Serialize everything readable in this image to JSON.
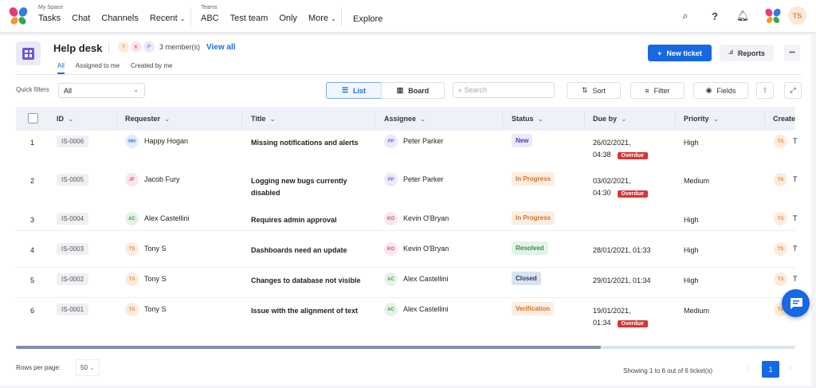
{
  "nav": {
    "my_space_label": "My Space",
    "my_space_items": [
      "Tasks",
      "Chat",
      "Channels",
      "Recent"
    ],
    "teams_label": "Teams",
    "team_items": [
      "ABC",
      "Test team",
      "Only",
      "More"
    ],
    "explore": "Explore",
    "user_initials": "TS"
  },
  "header": {
    "title": "Help desk",
    "members": [
      "T",
      "K",
      "P"
    ],
    "member_count": "3 member(s)",
    "view_all": "View all",
    "tabs": [
      "All",
      "Assigned to me",
      "Created by me"
    ],
    "new_ticket": "New ticket",
    "reports": "Reports",
    "more": "•••"
  },
  "toolbar": {
    "quick_filters_label": "Quick filters",
    "quick_filter_value": "All",
    "list": "List",
    "board": "Board",
    "search_placeholder": "Search",
    "sort": "Sort",
    "filter": "Filter",
    "fields": "Fields"
  },
  "columns": [
    "ID",
    "Requester",
    "Title",
    "Assignee",
    "Status",
    "Due by",
    "Priority",
    "Create"
  ],
  "rows": [
    {
      "n": "1",
      "id": "IS-0006",
      "req_init": "HH",
      "req": "Happy Hogan",
      "title": [
        "Missing notifications and alerts"
      ],
      "asg_init": "PP",
      "asg": "Peter Parker",
      "status": "New",
      "due": [
        "26/02/2021,",
        "04:38"
      ],
      "overdue": "Overdue",
      "priority": "High",
      "created_init": "TS",
      "created": "T"
    },
    {
      "n": "2",
      "id": "IS-0005",
      "req_init": "JF",
      "req": "Jacob Fury",
      "title": [
        "Logging new bugs currently",
        "disabled"
      ],
      "asg_init": "PP",
      "asg": "Peter Parker",
      "status": "In Progress",
      "due": [
        "03/02/2021,",
        "04:30"
      ],
      "overdue": "Overdue",
      "priority": "Medium",
      "created_init": "TS",
      "created": "T"
    },
    {
      "n": "3",
      "id": "IS-0004",
      "req_init": "AC",
      "req": "Alex Castellini",
      "title": [
        "Requires admin approval"
      ],
      "asg_init": "KO",
      "asg": "Kevin O'Bryan",
      "status": "In Progress",
      "due": [],
      "priority": "High",
      "created_init": "TS",
      "created": "T"
    },
    {
      "n": "4",
      "id": "IS-0003",
      "req_init": "TS",
      "req": "Tony S",
      "title": [
        "Dashboards need an update"
      ],
      "asg_init": "KO",
      "asg": "Kevin O'Bryan",
      "status": "Resolved",
      "due": [
        "28/01/2021, 01:33"
      ],
      "priority": "High",
      "created_init": "TS",
      "created": "T"
    },
    {
      "n": "5",
      "id": "IS-0002",
      "req_init": "TS",
      "req": "Tony S",
      "title": [
        "Changes to database not visible"
      ],
      "asg_init": "AC",
      "asg": "Alex Castellini",
      "status": "Closed",
      "due": [
        "29/01/2021, 01:34"
      ],
      "priority": "High",
      "created_init": "TS",
      "created": "T"
    },
    {
      "n": "6",
      "id": "IS-0001",
      "req_init": "TS",
      "req": "Tony S",
      "title": [
        "Issue with the alignment of text"
      ],
      "asg_init": "AC",
      "asg": "Alex Castellini",
      "status": "Verification",
      "due": [
        "19/01/2021,",
        "01:34"
      ],
      "overdue": "Overdue",
      "priority": "Medium",
      "created_init": "TS",
      "created": "T"
    }
  ],
  "status_colors": {
    "New": [
      "#ece9fb",
      "#4b3fb5"
    ],
    "In Progress": [
      "#fdeee2",
      "#d2712a"
    ],
    "Resolved": [
      "#e3f4e6",
      "#3b8a4b"
    ],
    "Closed": [
      "#d9e3ef",
      "#2d3d55"
    ],
    "Verification": [
      "#fdeee2",
      "#d2712a"
    ]
  },
  "avatar_colors": {
    "HH": [
      "#e3ecfb",
      "#2f6fd6"
    ],
    "JF": [
      "#fbe5ef",
      "#d04a86"
    ],
    "AC": [
      "#e3f4e6",
      "#3b9a50"
    ],
    "TS": [
      "#fdebdc",
      "#e88a3c"
    ],
    "PP": [
      "#ece9fb",
      "#7a6ad0"
    ],
    "KO": [
      "#fbe5ef",
      "#d04a86"
    ]
  },
  "footer": {
    "rows_per_page_label": "Rows per page:",
    "rows_per_page": "50",
    "showing": "Showing 1 to 6 out of 6 ticket(s)",
    "page": "1"
  }
}
